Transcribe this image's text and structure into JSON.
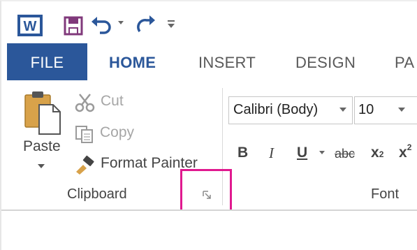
{
  "qat": {
    "app_icon": "word-icon",
    "save_icon": "save-icon",
    "undo_icon": "undo-icon",
    "redo_icon": "redo-icon",
    "customize_icon": "customize-qat-icon"
  },
  "tabs": [
    {
      "label": "FILE"
    },
    {
      "label": "HOME"
    },
    {
      "label": "INSERT"
    },
    {
      "label": "DESIGN"
    },
    {
      "label": "PA"
    }
  ],
  "clipboard": {
    "paste_label": "Paste",
    "cut_label": "Cut",
    "copy_label": "Copy",
    "format_painter_label": "Format Painter",
    "group_label": "Clipboard",
    "launcher_icon": "dialog-launcher-icon"
  },
  "font": {
    "font_name": "Calibri (Body)",
    "font_size": "10",
    "bold": "B",
    "italic": "I",
    "underline": "U",
    "strikethrough": "abc",
    "subscript_x": "x",
    "subscript_2": "2",
    "superscript_x": "x",
    "superscript_2": "2",
    "group_label": "Font"
  },
  "colors": {
    "file_tab": "#2b579a",
    "home_tab": "#2b579a",
    "highlight_box": "#e0198f",
    "save_icon": "#80397b"
  }
}
